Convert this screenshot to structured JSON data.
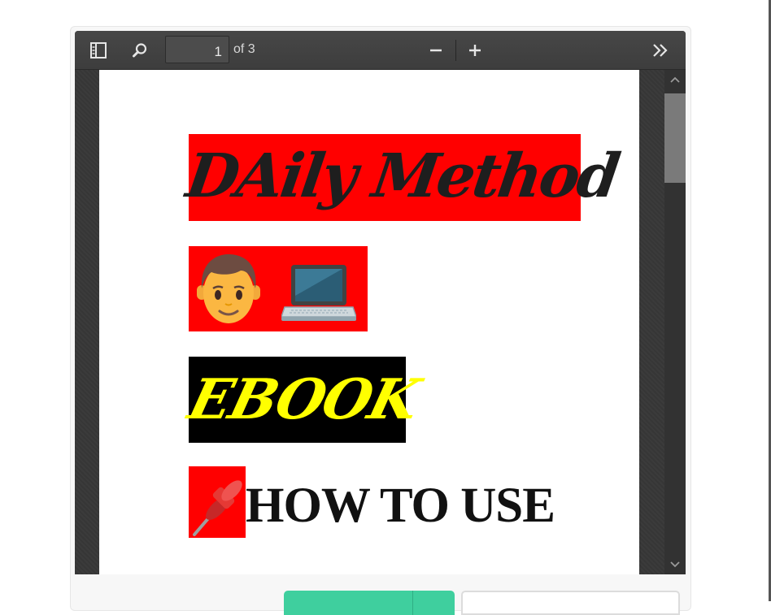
{
  "toolbar": {
    "sidebar_icon": "sidebar-toggle-icon",
    "search_icon": "search-icon",
    "page_number": "1",
    "page_count_label": "of 3",
    "zoom_out_icon": "minus-icon",
    "zoom_in_icon": "plus-icon",
    "tools_icon": "double-chevron-right-icon"
  },
  "document": {
    "title": "DAily Method",
    "emojis": [
      "man-face-icon",
      "laptop-icon"
    ],
    "subtitle": "EBOOK",
    "pin_icon": "pushpin-icon",
    "heading": "HOW TO USE"
  },
  "scrollbar": {
    "up_icon": "chevron-up-icon",
    "down_icon": "chevron-down-icon"
  },
  "colors": {
    "toolbar_bg": "#444444",
    "page_bg": "#ffffff",
    "title_highlight": "#ff0000",
    "ebook_bg": "#000000",
    "ebook_text": "#ffff00",
    "button_green": "#3fcf9e"
  }
}
